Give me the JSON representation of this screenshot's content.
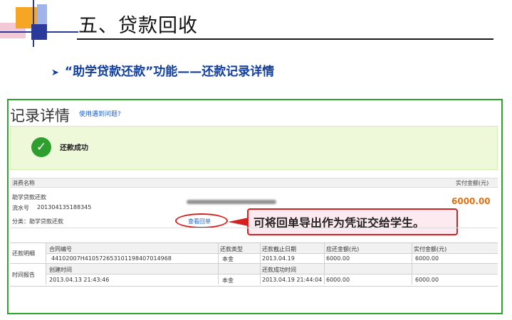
{
  "slide": {
    "title": "五、贷款回收",
    "bullet": "“助学贷款还款”功能——还款记录详情"
  },
  "record": {
    "title": "记录详情",
    "help_link": "使用遇到问题?",
    "success_text": "还款成功",
    "header_left": "消费名称",
    "header_right": "实付金额(元)",
    "item_name": "助学贷款还款",
    "serial_label": "流水号",
    "serial_value": "201304135188345",
    "amount": "6000.00",
    "category": "分类：助学贷款还款",
    "view_receipt": "查看回单",
    "callout": "可将回单导出作为凭证交给学生。"
  },
  "details": {
    "section1_label": "还款明细",
    "section2_label": "时间报告",
    "headers": [
      "合同编号",
      "还款类型",
      "还款截止日期",
      "应还金额(元)",
      "实付金额(元)"
    ],
    "row1": [
      "44102007H41057265310119840701496​8",
      "本金",
      "2013.04.19",
      "6000.00",
      "6000.00"
    ],
    "time_headers": [
      "创建时间",
      "还款成功时间"
    ],
    "row2": [
      "2013.04.13 21:43:46",
      "本金",
      "2013.04.19 21:44:04",
      "6000.00",
      "6000.00"
    ]
  }
}
